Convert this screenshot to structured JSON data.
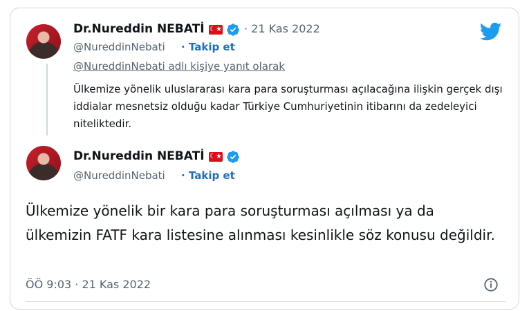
{
  "reply": {
    "author_name": "Dr.Nureddin NEBATİ",
    "flag_glyph": "☾★",
    "date": "· 21 Kas 2022",
    "handle": "@NureddinNebati",
    "follow_label": "· Takip et",
    "reply_context": "@NureddinNebati adlı kişiye yanıt olarak",
    "text": "Ülkemize yönelik uluslararası kara para soruşturması açılacağına ilişkin gerçek dışı iddialar mesnetsiz olduğu kadar Türkiye Cumhuriyetinin itibarını da zedeleyici niteliktedir."
  },
  "main": {
    "author_name": "Dr.Nureddin NEBATİ",
    "flag_glyph": "☾★",
    "handle": "@NureddinNebati",
    "follow_label": "· Takip et",
    "text": "Ülkemize yönelik bir kara para soruşturması açılması ya da ülkemizin FATF kara listesine alınması kesinlikle söz konusu değildir.",
    "timestamp": "ÖÖ 9:03 · 21 Kas 2022"
  },
  "icons": {
    "verified": "verified-badge-icon",
    "twitter": "twitter-bird-icon",
    "info": "info-icon",
    "flag": "turkey-flag-icon"
  },
  "colors": {
    "verified": "#1d9bf0",
    "link": "#1d6fc2",
    "muted": "#536471",
    "flag_red": "#e30a17"
  }
}
